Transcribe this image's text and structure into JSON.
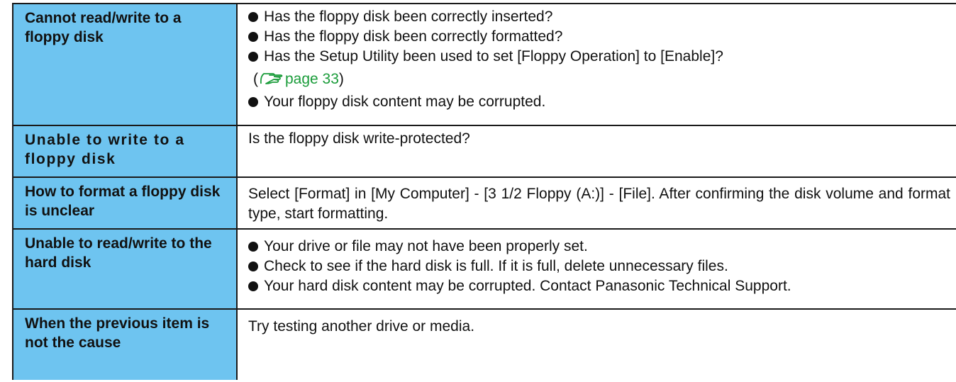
{
  "rows": [
    {
      "problem": "Cannot read/write to a floppy disk",
      "bullets": [
        "Has the floppy disk been correctly inserted?",
        "Has the floppy disk been correctly formatted?",
        "Has the Setup Utility been used to set [Floppy Operation] to [Enable]?",
        "Your floppy disk content may be corrupted."
      ],
      "ref_open": "(",
      "ref_text": "page 33",
      "ref_close": ")"
    },
    {
      "problem": "Unable to write to a floppy disk",
      "text": "Is the floppy disk write-protected?"
    },
    {
      "problem": "How to format a floppy disk is unclear",
      "text": "Select [Format] in [My Computer] - [3 1/2 Floppy (A:)]  - [File]. After confirming the disk volume and format type, start formatting."
    },
    {
      "problem": "Unable to read/write to the hard disk",
      "bullets": [
        "Your drive or file may not have been properly set.",
        "Check to see if the hard disk is full. If it is full, delete unnecessary files.",
        "Your hard disk content may be corrupted. Contact Panasonic Technical Support."
      ]
    },
    {
      "problem": "When the previous item is not the cause",
      "text": "Try testing another drive or media."
    }
  ],
  "colors": {
    "header_cell": "#6ec4f0",
    "reference": "#1a9c3a",
    "border": "#1a1a1a"
  },
  "icons": {
    "reference": "pointing-hand-icon",
    "bullet": "bullet-dot"
  }
}
